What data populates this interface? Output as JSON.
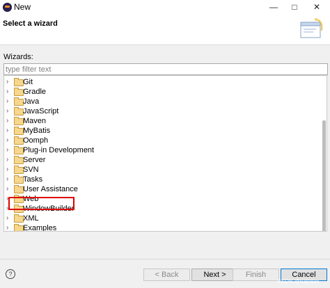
{
  "window": {
    "title": "New",
    "minimize_icon": "minimize-icon",
    "maximize_icon": "maximize-icon",
    "close_icon": "close-icon"
  },
  "header": {
    "title": "Select a wizard"
  },
  "wizards": {
    "label": "Wizards:",
    "filter_placeholder": "type filter text",
    "filter_value": "",
    "items": [
      {
        "label": "Git"
      },
      {
        "label": "Gradle"
      },
      {
        "label": "Java"
      },
      {
        "label": "JavaScript"
      },
      {
        "label": "Maven"
      },
      {
        "label": "MyBatis"
      },
      {
        "label": "Oomph"
      },
      {
        "label": "Plug-in Development"
      },
      {
        "label": "Server"
      },
      {
        "label": "SVN"
      },
      {
        "label": "Tasks"
      },
      {
        "label": "User Assistance"
      },
      {
        "label": "Web"
      },
      {
        "label": "WindowBuilder",
        "highlighted": true
      },
      {
        "label": "XML"
      },
      {
        "label": "Examples"
      }
    ]
  },
  "buttons": {
    "back": "< Back",
    "next": "Next >",
    "finish": "Finish",
    "cancel": "Cancel"
  },
  "watermark": "CSDN @ruijialan",
  "colors": {
    "highlight_border": "#e00000",
    "folder": "#f5d78e"
  }
}
